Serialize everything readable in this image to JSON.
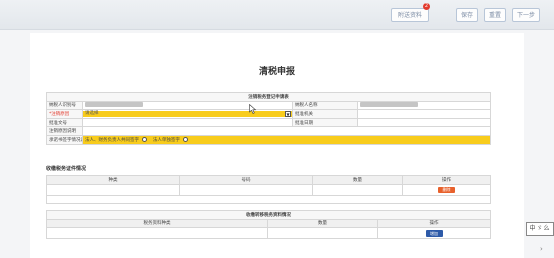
{
  "toolbar": {
    "attach_label": "附送资料",
    "attach_badge": "2",
    "save_label": "保存",
    "reset_label": "重置",
    "next_label": "下一步"
  },
  "page_title": "清税申报",
  "registration": {
    "header": "注销税务登记申请表",
    "taxpayer_id_label": "纳税人识别号",
    "taxpayer_name_label": "纳税人名称",
    "reason_label": "*注销原因",
    "reason_select_value": "请选择",
    "approve_org_label": "批准机关",
    "approve_doc_label": "批准文号",
    "approve_date_label": "批准日期",
    "reason_desc_label": "注销原因说明",
    "sign_label": "承诺书签字情况说明",
    "sign_option_1": "法人、财务负责人共同签字",
    "sign_option_2": "法人单独签字"
  },
  "certificates": {
    "section_title": "收缴税务证件情况",
    "columns": [
      "种类",
      "号码",
      "数量",
      "操作"
    ],
    "delete_label": "删除"
  },
  "materials": {
    "section_title": "收缴转移税务资料情况",
    "columns": [
      "税务资料种类",
      "数量",
      "操作"
    ],
    "add_label": "增加"
  },
  "stamp_text": "中ゞ么"
}
